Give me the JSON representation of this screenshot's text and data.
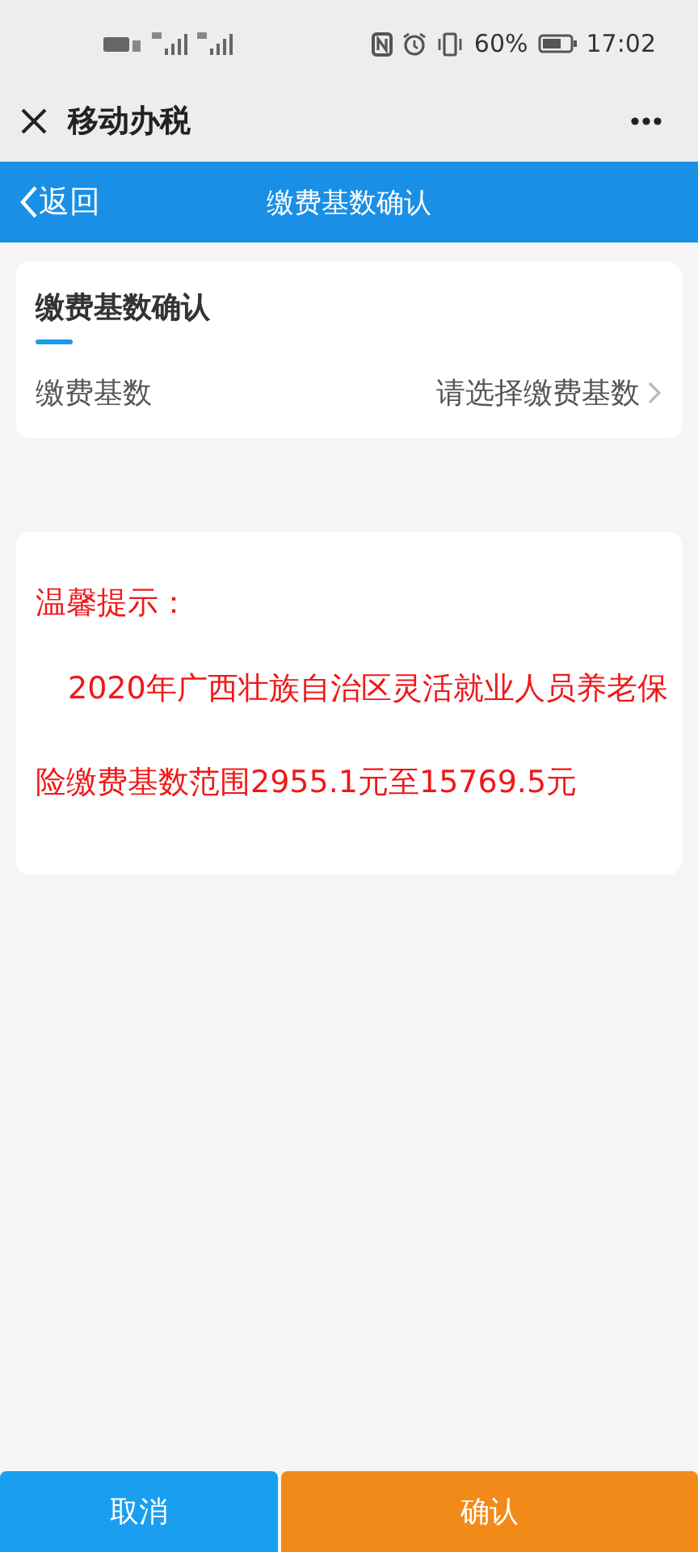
{
  "status_bar": {
    "battery": "60%",
    "time": "17:02"
  },
  "app_bar": {
    "title": "移动办税"
  },
  "nav_bar": {
    "back": "返回",
    "title": "缴费基数确认"
  },
  "form_card": {
    "title": "缴费基数确认",
    "rows": [
      {
        "label": "缴费基数",
        "placeholder": "请选择缴费基数"
      }
    ]
  },
  "notice": {
    "title": "温馨提示：",
    "text": "2020年广西壮族自治区灵活就业人员养老保险缴费基数范围2955.1元至15769.5元"
  },
  "buttons": [
    {
      "label": "取消",
      "kind": "secondary"
    },
    {
      "label": "确认",
      "kind": "primary"
    }
  ]
}
